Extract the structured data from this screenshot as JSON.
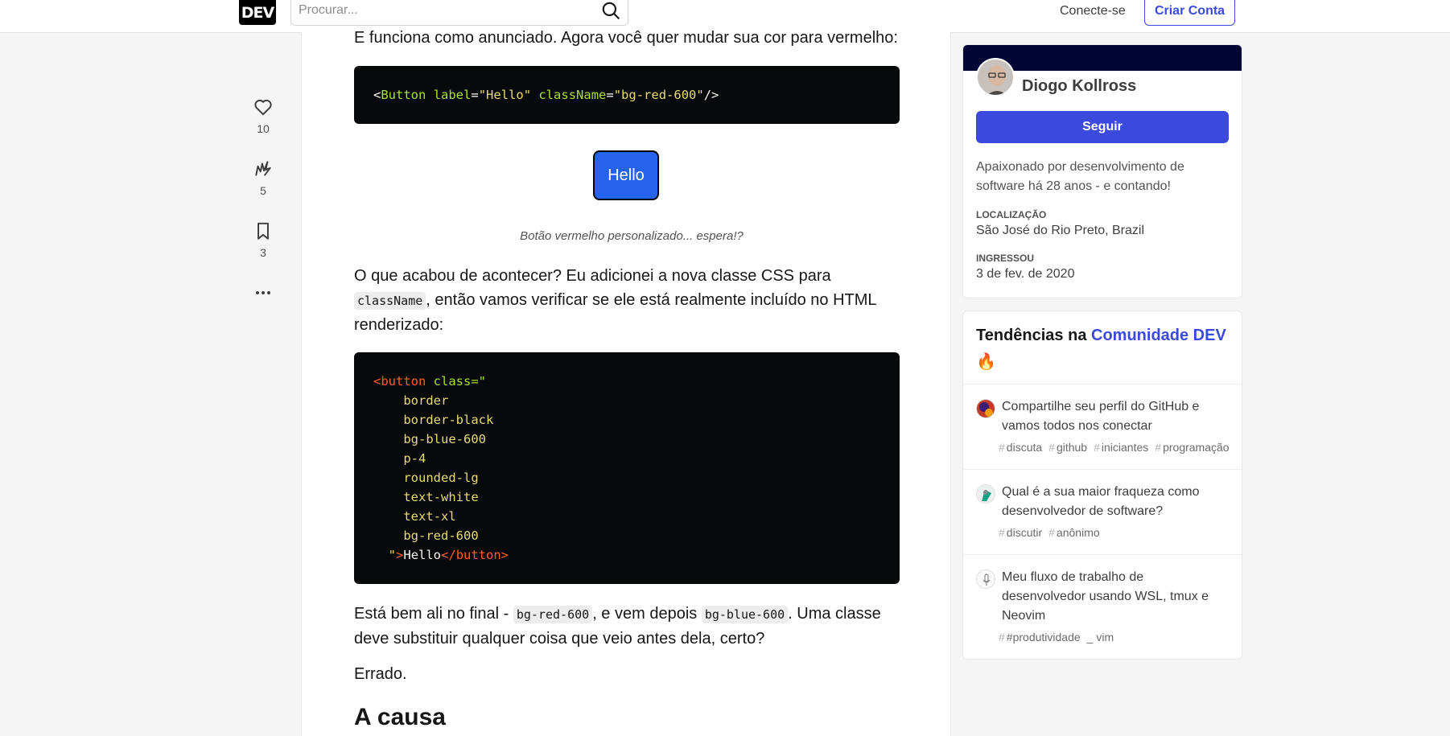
{
  "header": {
    "logo": "DEV",
    "search_placeholder": "Procurar...",
    "login": "Conecte-se",
    "signup": "Criar Conta"
  },
  "reactions": {
    "likes": "10",
    "unicorns": "5",
    "saves": "3"
  },
  "article": {
    "p1": "E funciona como anunciado. Agora você quer mudar sua cor para vermelho:",
    "code1": {
      "open": "<",
      "tag": "Button",
      "attr1": "label",
      "eq": "=",
      "val1": "\"Hello\"",
      "attr2": "className",
      "val2": "\"bg-red-600\"",
      "close": "/>"
    },
    "hello_button": "Hello",
    "caption": "Botão vermelho personalizado... espera!?",
    "p2_a": "O que acabou de acontecer? Eu adicionei a nova classe CSS para",
    "p2_code": "className",
    "p2_b": ", então vamos verificar se ele está realmente incluído no HTML renderizado:",
    "code2": {
      "open_tag": "<button",
      "class_attr": " class=\"",
      "classes": [
        "border",
        "border-black",
        "bg-blue-600",
        "p-4",
        "rounded-lg",
        "text-white",
        "text-xl",
        "bg-red-600"
      ],
      "quote": "\"",
      "gt": ">",
      "text": "Hello",
      "close_tag": "</button>"
    },
    "p3_a": "Está bem ali no final - ",
    "p3_code1": "bg-red-600",
    "p3_b": ", e vem depois ",
    "p3_code2": "bg-blue-600",
    "p3_c": ". Uma classe deve substituir qualquer coisa que veio antes dela, certo?",
    "p4": "Errado.",
    "h2": "A causa"
  },
  "profile": {
    "name": "Diogo Kollross",
    "follow": "Seguir",
    "bio": "Apaixonado por desenvolvimento de software há 28 anos - e contando!",
    "location_label": "LOCALIZAÇÃO",
    "location": "São José do Rio Preto, Brazil",
    "joined_label": "INGRESSOU",
    "joined": "3 de fev. de 2020"
  },
  "trending": {
    "title_prefix": "Tendências na ",
    "title_highlight": "Comunidade DEV",
    "emoji": "🔥",
    "items": [
      {
        "title": "Compartilhe seu perfil do GitHub e vamos todos nos conectar",
        "tags": [
          "discuta",
          "github",
          "iniciantes",
          "programação"
        ]
      },
      {
        "title": "Qual é a sua maior fraqueza como desenvolvedor de software?",
        "tags": [
          "discutir",
          "anônimo"
        ]
      },
      {
        "title": "Meu fluxo de trabalho de desenvolvedor usando WSL, tmux e Neovim",
        "tags": [
          "#produtividade",
          "_ vim"
        ]
      }
    ]
  }
}
